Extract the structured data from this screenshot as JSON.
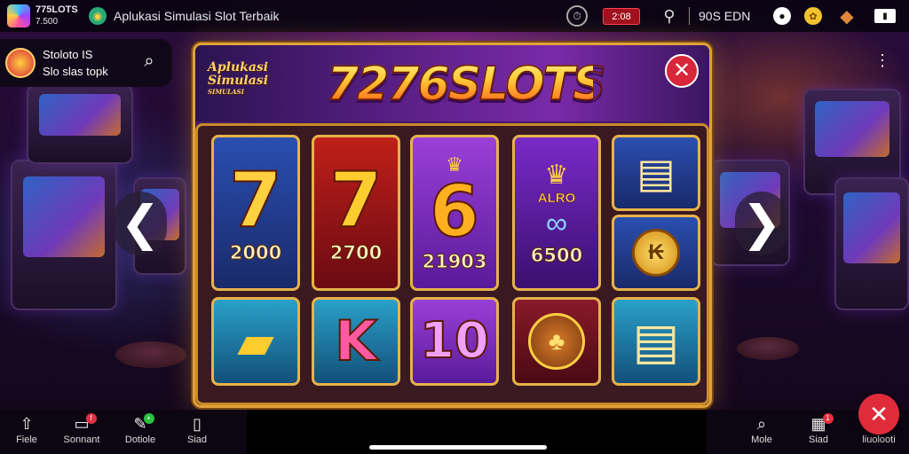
{
  "statusbar": {
    "app_short_name": "775LOTS",
    "app_short_sub": "7.500",
    "page_title": "Aplukasi Simulasi Slot Terbaik",
    "recording_label": "2:08",
    "right_text": "90S EDN",
    "icons": [
      "app-logo-icon",
      "globe-icon",
      "clock-icon",
      "record-icon",
      "game-icon",
      "profile-icon",
      "coin-icon",
      "gift-icon",
      "battery-icon"
    ]
  },
  "search_chip": {
    "title": "Stoloto IS",
    "subtitle": "Slo slas topk"
  },
  "panel": {
    "title": "7276SLOTS",
    "subtitle_line1": "Aplukasi",
    "subtitle_line2": "Simulasi",
    "subtitle_line3": "SIMULASI",
    "close_symbol": "✕"
  },
  "tiles": [
    {
      "symbol": "7",
      "value": "2000",
      "color": "blue"
    },
    {
      "symbol": "7",
      "value": "2700",
      "color": "red"
    },
    {
      "symbol": "6",
      "value": "21903",
      "color": "purple"
    },
    {
      "symbol": "ALRO",
      "value": "6500",
      "color": "violet",
      "icon": "crown-icon"
    },
    {
      "symbol": "",
      "value": "",
      "color": "blue",
      "icon": "ticket-icon"
    },
    {
      "symbol": "",
      "value": "",
      "color": "blue",
      "icon": "coin-icon"
    },
    {
      "symbol": "",
      "value": "",
      "color": "teal",
      "icon": "gold-bars-icon"
    },
    {
      "symbol": "K",
      "value": "",
      "color": "teal"
    },
    {
      "symbol": "10",
      "value": "",
      "color": "purple"
    },
    {
      "symbol": "",
      "value": "",
      "color": "brown",
      "icon": "treasure-pot-icon"
    },
    {
      "symbol": "",
      "value": "",
      "color": "teal",
      "icon": "ticket-icon"
    }
  ],
  "nav": {
    "left_symbol": "❮",
    "right_symbol": "❯"
  },
  "bottombar": {
    "items": [
      {
        "label": "Fiele",
        "icon": "home-icon"
      },
      {
        "label": "Sonnant",
        "icon": "chat-icon",
        "badge": "f"
      },
      {
        "label": "Dotiole",
        "icon": "pencil-icon",
        "badge": "+"
      },
      {
        "label": "Siad",
        "icon": "book-icon"
      },
      {
        "label": "Mole",
        "icon": "search-icon"
      },
      {
        "label": "Siad",
        "icon": "building-icon",
        "badge": "1"
      },
      {
        "label": "liuolooti",
        "icon": "close-icon"
      }
    ],
    "fab_symbol": "✕"
  },
  "colors": {
    "frame_gold": "#e0a23a",
    "close_red": "#d8263a",
    "panel_purple": "#4b1d6e"
  }
}
